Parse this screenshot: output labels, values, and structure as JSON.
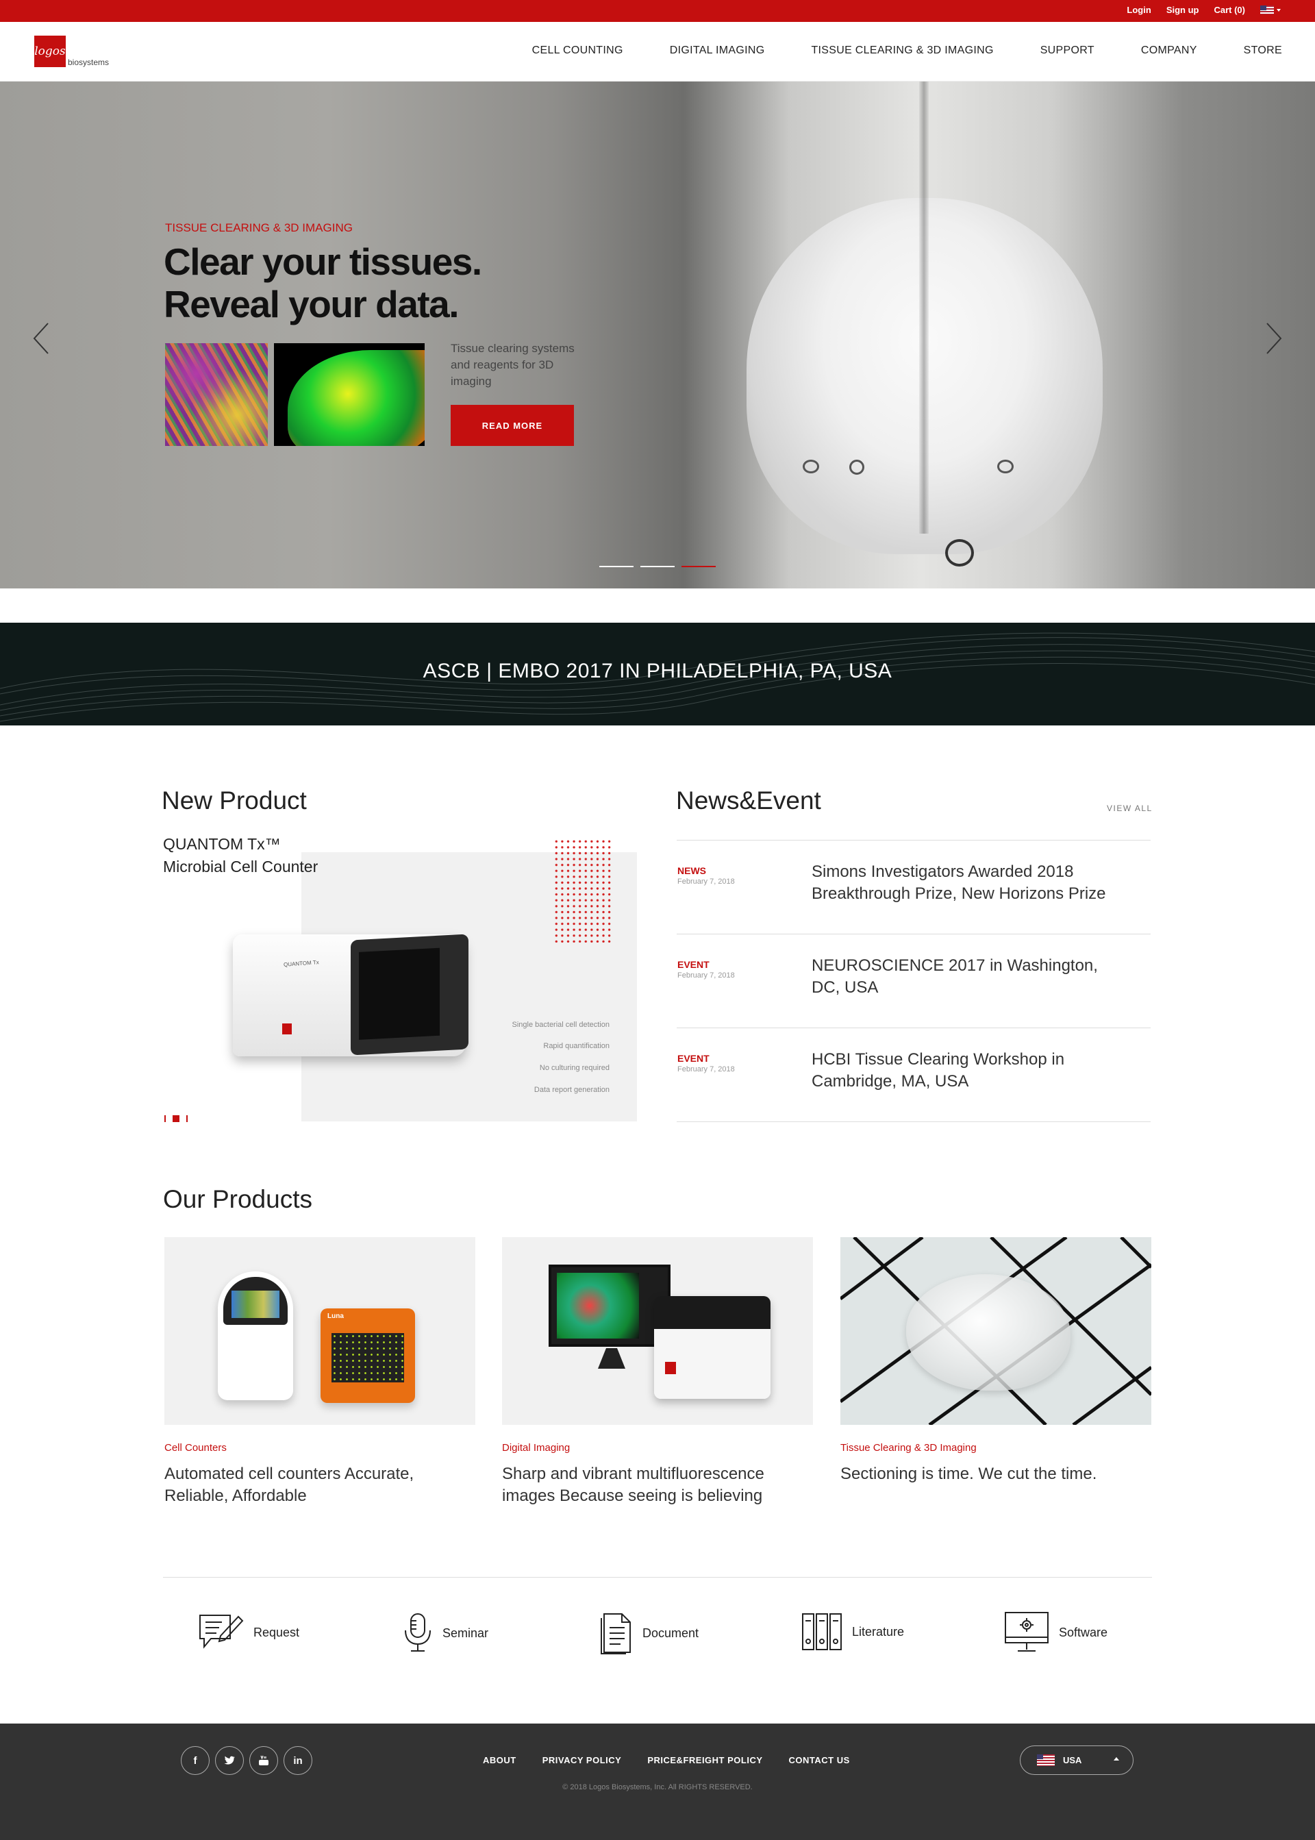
{
  "topbar": {
    "login": "Login",
    "signup": "Sign up",
    "cart": "Cart (0)",
    "locale_icon": "us-flag-icon"
  },
  "header": {
    "logo_mark": "logos",
    "logo_text": "biosystems",
    "nav": [
      "CELL COUNTING",
      "DIGITAL IMAGING",
      "TISSUE CLEARING & 3D IMAGING",
      "SUPPORT",
      "COMPANY",
      "STORE"
    ]
  },
  "hero": {
    "category": "TISSUE CLEARING & 3D IMAGING",
    "title_line1": "Clear your tissues.",
    "title_line2": "Reveal your data.",
    "description": "Tissue clearing systems and reagents for 3D imaging",
    "button": "READ MORE",
    "slides": 3,
    "active_slide": 3
  },
  "event_banner": {
    "title": "ASCB | EMBO 2017 IN PHILADELPHIA, PA, USA"
  },
  "new_product": {
    "heading": "New Product",
    "name_line1": "QUANTOM Tx™",
    "name_line2": "Microbial Cell Counter",
    "device_label": "QUANTOM Tx",
    "features": [
      "Single bacterial cell detection",
      "Rapid quantification",
      "No culturing required",
      "Data report generation"
    ]
  },
  "news": {
    "heading": "News&Event",
    "view_all": "VIEW ALL",
    "items": [
      {
        "type": "NEWS",
        "date": "February 7, 2018",
        "title": "Simons Investigators Awarded 2018 Breakthrough Prize, New Horizons Prize"
      },
      {
        "type": "EVENT",
        "date": "February 7, 2018",
        "title": "NEUROSCIENCE 2017 in Washington, DC, USA"
      },
      {
        "type": "EVENT",
        "date": "February 7, 2018",
        "title": "HCBI Tissue Clearing Workshop in Cambridge, MA, USA"
      }
    ]
  },
  "products": {
    "heading": "Our Products",
    "items": [
      {
        "category": "Cell Counters",
        "description": "Automated cell counters Accurate, Reliable, Affordable",
        "device_label": "Luna"
      },
      {
        "category": "Digital Imaging",
        "description": "Sharp and vibrant multifluorescence images Because seeing is believing"
      },
      {
        "category": "Tissue Clearing & 3D Imaging",
        "description": "Sectioning is time. We cut the time."
      }
    ]
  },
  "resources": [
    {
      "label": "Request",
      "icon": "request-form-icon"
    },
    {
      "label": "Seminar",
      "icon": "microphone-icon"
    },
    {
      "label": "Document",
      "icon": "document-icon"
    },
    {
      "label": "Literature",
      "icon": "binders-icon"
    },
    {
      "label": "Software",
      "icon": "monitor-gear-icon"
    }
  ],
  "footer": {
    "social": [
      "f",
      "t",
      "yt",
      "in"
    ],
    "links": [
      "ABOUT",
      "PRIVACY POLICY",
      "PRICE&FREIGHT POLICY",
      "CONTACT US"
    ],
    "copyright": "© 2018 Logos Biosystems, Inc. All RIGHTS RESERVED.",
    "region": "USA"
  },
  "colors": {
    "brand_red": "#c40f0f",
    "footer_bg": "#333333",
    "banner_bg": "#0f1a19"
  }
}
